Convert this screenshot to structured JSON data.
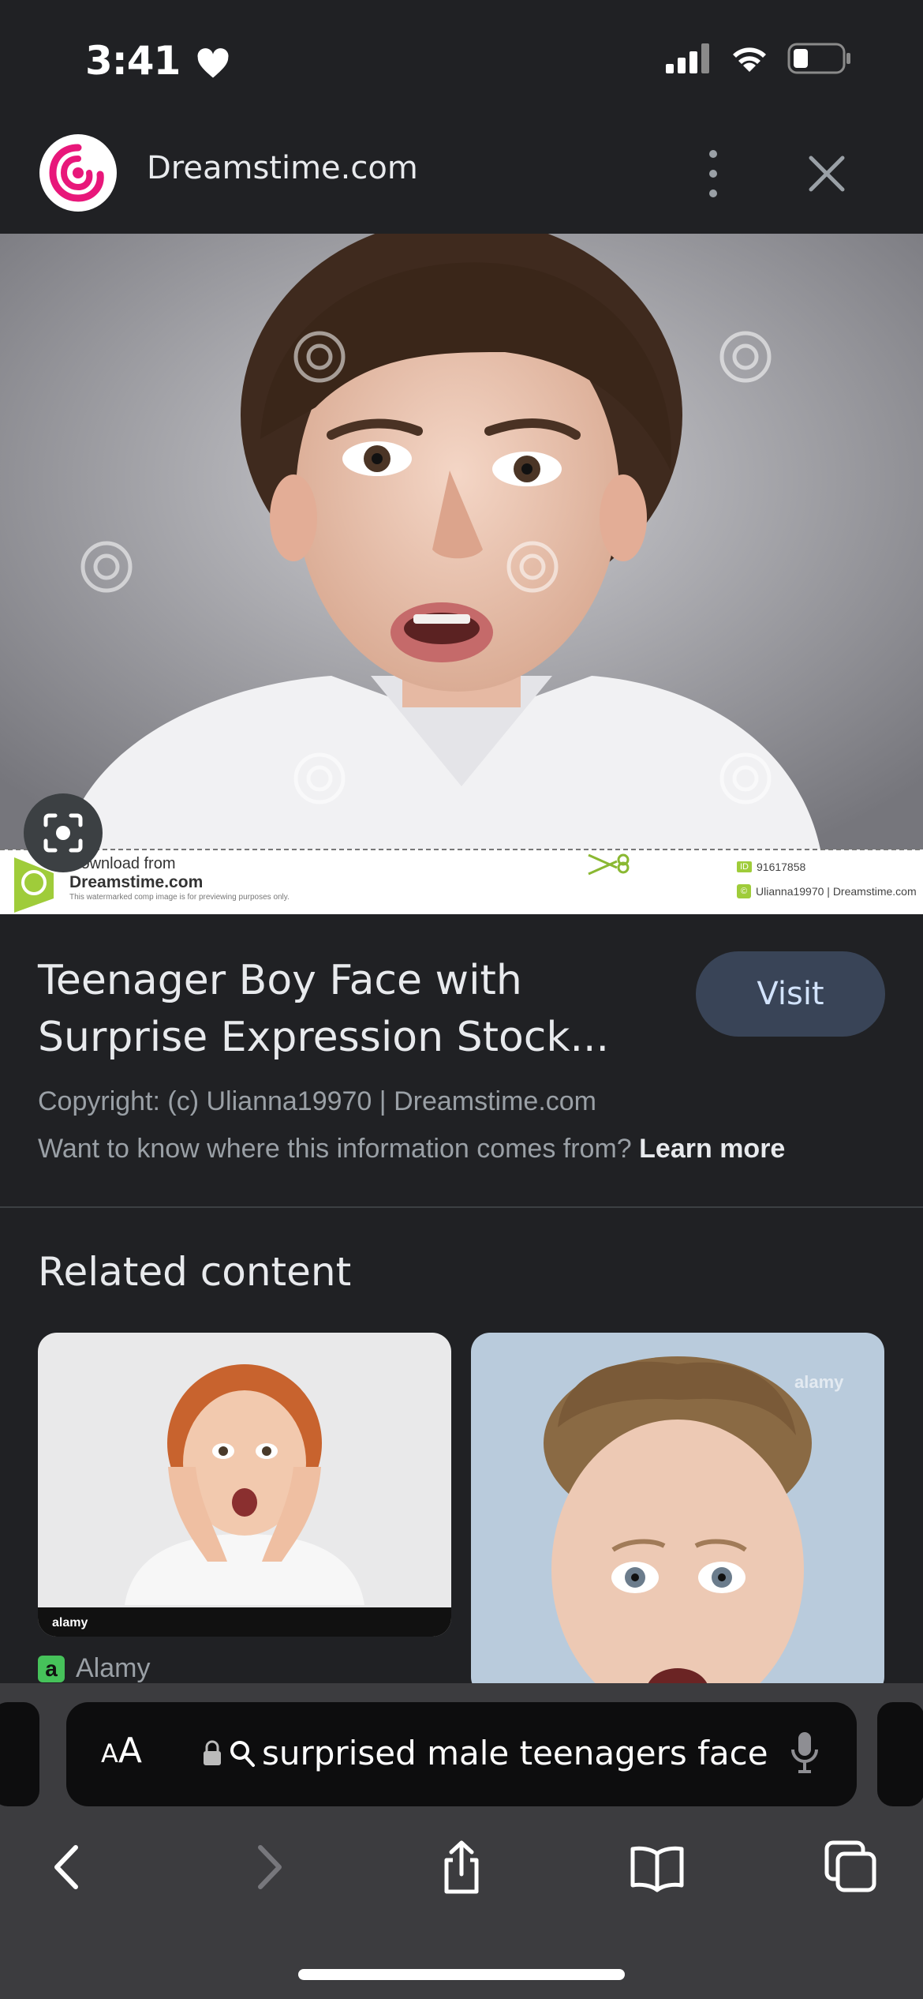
{
  "status": {
    "time": "3:41"
  },
  "header": {
    "site_name": "Dreamstime.com"
  },
  "image_footer": {
    "download_from": "Download from",
    "brand": "Dreamstime.com",
    "disclaimer": "This watermarked comp image is for previewing purposes only.",
    "id_label": "ID",
    "id_value": "91617858",
    "credit": "Ulianna19970 | Dreamstime.com"
  },
  "result": {
    "title": "Teenager Boy Face with Surprise Expression Stock...",
    "visit_label": "Visit",
    "copyright": "Copyright: (c) Ulianna19970 | Dreamstime.com",
    "info_question": "Want to know where this information comes from?",
    "learn_more": "Learn more"
  },
  "related": {
    "heading": "Related content",
    "items": [
      {
        "source": "Alamy"
      },
      {
        "source": "alamy"
      }
    ]
  },
  "address_bar": {
    "text_size_label": "AA",
    "query": "surprised male teenagers face"
  },
  "colors": {
    "background": "#202124",
    "visit_button": "#394457",
    "bottom_panel": "#3c3c3f"
  }
}
